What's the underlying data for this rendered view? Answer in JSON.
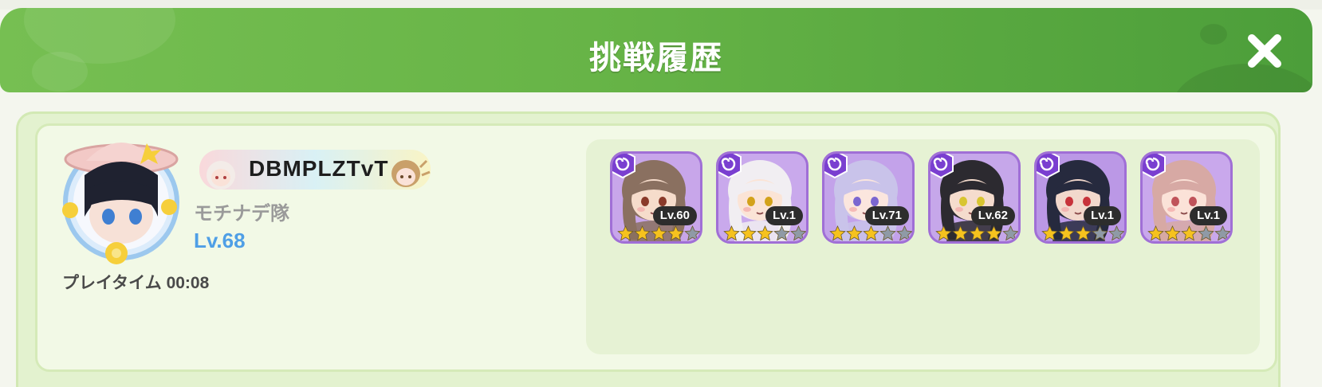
{
  "header": {
    "title": "挑戦履歴",
    "close_icon": "close-icon",
    "colors": {
      "start": "#76bf52",
      "end": "#4c9e3a"
    }
  },
  "player": {
    "name": "DBMPLZTvT",
    "guild": "モチナデ隊",
    "level": "Lv.68",
    "playtime": "プレイタイム 00:08",
    "avatar_icon": "player-avatar"
  },
  "team": {
    "element_icon": "swirl-element-icon",
    "characters": [
      {
        "level": "Lv.60",
        "stars": 4,
        "hair": "#8a7060",
        "skin": "#f6dccb",
        "eye": "#8a3a2a",
        "bg": "#c8a6ea"
      },
      {
        "level": "Lv.1",
        "stars": 3,
        "hair": "#f1eef2",
        "skin": "#fbe4d6",
        "eye": "#d3a21a",
        "bg": "#c9a9ec"
      },
      {
        "level": "Lv.71",
        "stars": 3,
        "hair": "#c9c3ea",
        "skin": "#fbe6de",
        "eye": "#7b66d0",
        "bg": "#c3a2ea"
      },
      {
        "level": "Lv.62",
        "stars": 4,
        "hair": "#2c2a30",
        "skin": "#f5dccd",
        "eye": "#d8c530",
        "bg": "#c6a7ea"
      },
      {
        "level": "Lv.1",
        "stars": 3,
        "hair": "#262a3e",
        "skin": "#f2d8cc",
        "eye": "#c7323a",
        "bg": "#bb98e6"
      },
      {
        "level": "Lv.1",
        "stars": 3,
        "hair": "#d7a9a4",
        "skin": "#fbe2d8",
        "eye": "#c0535a",
        "bg": "#c9a8ec"
      }
    ],
    "max_stars": 5,
    "colors": {
      "star_on": "#f6c21e",
      "star_off": "#8f9aa6"
    }
  }
}
